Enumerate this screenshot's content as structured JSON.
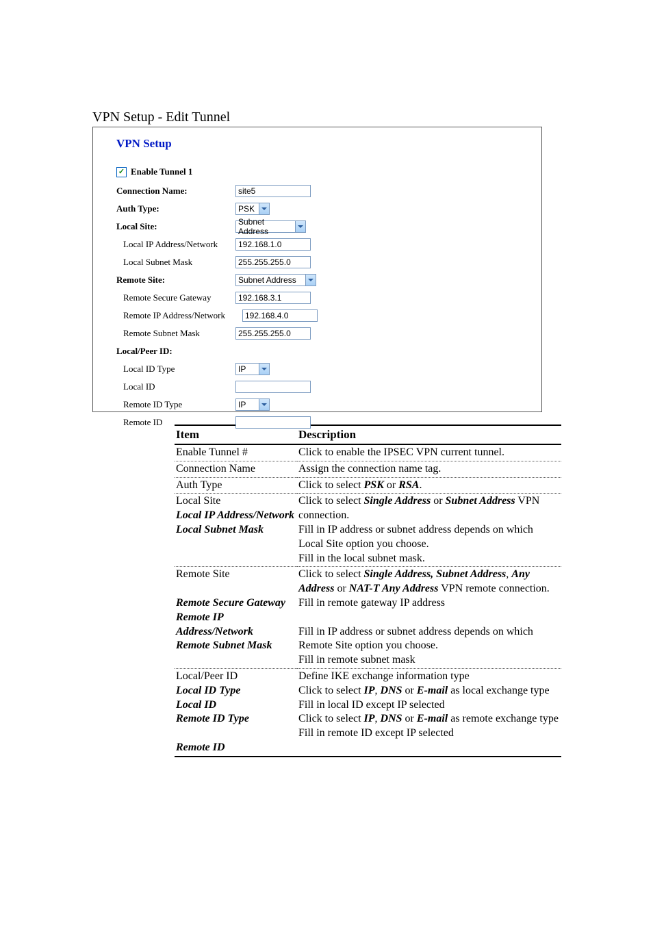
{
  "pageTitle": "VPN Setup - Edit Tunnel",
  "form": {
    "title": "VPN Setup",
    "enable": {
      "label": "Enable Tunnel 1",
      "checked": true
    },
    "connName": {
      "label": "Connection Name",
      "colon": ":",
      "value": "site5"
    },
    "authType": {
      "label": "Auth Type",
      "colon": ":",
      "value": "PSK"
    },
    "localSite": {
      "label": "Local Site",
      "colon": ":",
      "value": "Subnet Address"
    },
    "localIp": {
      "label": "Local IP Address/Network",
      "value": "192.168.1.0"
    },
    "localMask": {
      "label": "Local Subnet Mask",
      "value": "255.255.255.0"
    },
    "remoteSite": {
      "label": "Remote Site",
      "colon": ":",
      "value": "Subnet Address"
    },
    "remoteGw": {
      "label": "Remote Secure Gateway",
      "value": "192.168.3.1"
    },
    "remoteIp": {
      "label": "Remote IP Address/Network",
      "value": "192.168.4.0"
    },
    "remoteMask": {
      "label": "Remote Subnet Mask",
      "value": "255.255.255.0"
    },
    "localPeerId": {
      "label": "Local/Peer ID",
      "colon": ":"
    },
    "localIdType": {
      "label": "Local ID Type",
      "value": "IP"
    },
    "localId": {
      "label": "Local ID",
      "value": ""
    },
    "remoteIdType": {
      "label": "Remote ID Type",
      "value": "IP"
    },
    "remoteId": {
      "label": "Remote ID",
      "value": ""
    }
  },
  "table": {
    "header": {
      "item": "Item",
      "desc": "Description"
    },
    "rows": [
      {
        "item": "Enable Tunnel #",
        "descHtml": "Click to enable the IPSEC VPN current tunnel."
      },
      {
        "item": "Connection Name",
        "descHtml": "Assign the connection name tag."
      },
      {
        "item": "Auth Type",
        "descHtml": "Click to select <span class='bi'>PSK</span> or <span class='bi'>RSA</span>."
      },
      {
        "itemHtml": "Local Site<br><span class='bi'>Local IP Address/Network</span><br><span class='bi'>Local Subnet Mask</span>",
        "descHtml": "Click to select <span class='bi'>Single Address</span> or <span class='bi'>Subnet Address</span> VPN connection.<br>Fill in IP address or subnet address depends on which Local Site option you choose.<br>Fill in the local subnet mask."
      },
      {
        "itemHtml": "Remote Site<br><br><span class='bi'>Remote Secure Gateway</span><br><span class='bi'>Remote IP Address/Network</span><br><span class='bi'>Remote Subnet Mask</span>",
        "descHtml": "Click to select <span class='bi'>Single Address, Subnet Address</span>, <span class='bi'>Any Address</span> or <span class='bi'>NAT-T Any Address</span> VPN remote connection.<br>Fill in remote gateway IP address<br><br>Fill in IP address or subnet address depends on which Remote Site option you choose.<br>Fill in remote subnet mask"
      },
      {
        "itemHtml": "Local/Peer ID<br><span class='bi'>Local ID Type</span><br><span class='bi'>Local ID</span><br><span class='bi'>Remote ID Type</span><br><br><span class='bi'>Remote ID</span>",
        "descHtml": "Define IKE exchange information type<br>Click to select <span class='bi'>IP</span>, <span class='bi'>DNS</span> or <span class='bi'>E-mail</span> as local exchange type<br>Fill in local ID except IP selected<br>Click to select <span class='bi'>IP</span>, <span class='bi'>DNS</span> or <span class='bi'>E-mail</span> as remote exchange type<br>Fill in remote ID except IP selected",
        "bottomThick": true
      }
    ]
  }
}
